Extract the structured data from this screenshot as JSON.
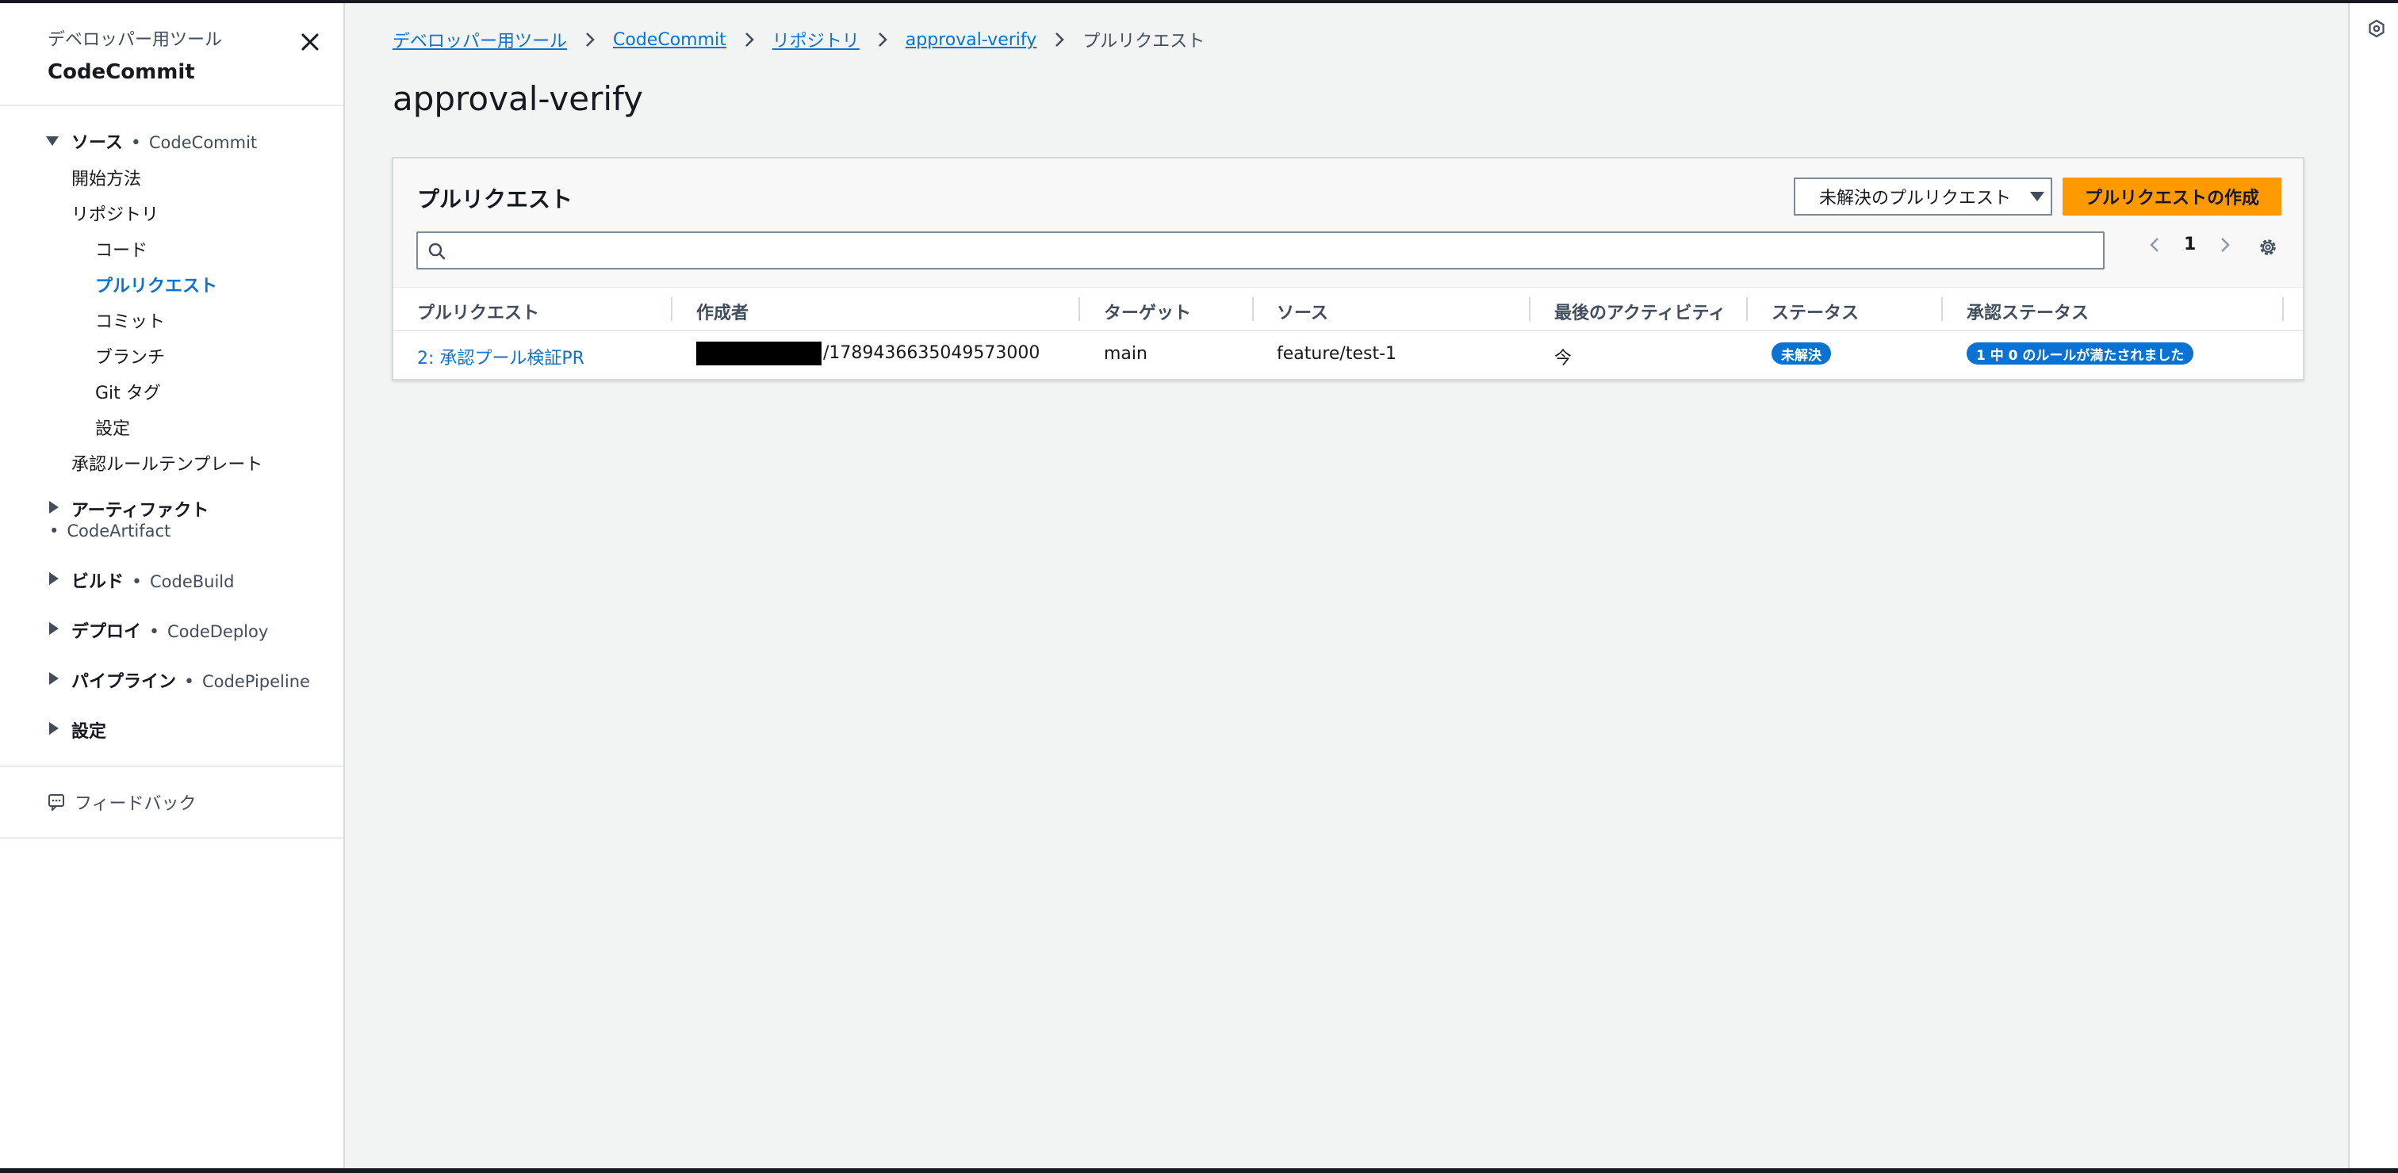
{
  "sidebar": {
    "supertitle": "デベロッパー用ツール",
    "title": "CodeCommit",
    "sections": {
      "source": {
        "label": "ソース",
        "service": "CodeCommit"
      },
      "artifact": {
        "label": "アーティファクト",
        "service": "CodeArtifact"
      },
      "build": {
        "label": "ビルド",
        "service": "CodeBuild"
      },
      "deploy": {
        "label": "デプロイ",
        "service": "CodeDeploy"
      },
      "pipeline": {
        "label": "パイプライン",
        "service": "CodePipeline"
      },
      "settings": {
        "label": "設定"
      }
    },
    "items": {
      "getting_started": "開始方法",
      "repositories": "リポジトリ",
      "code": "コード",
      "pull_requests": "プルリクエスト",
      "commits": "コミット",
      "branches": "ブランチ",
      "git_tags": "Git タグ",
      "repo_settings": "設定",
      "approval_templates": "承認ルールテンプレート"
    },
    "feedback": "フィードバック"
  },
  "breadcrumbs": {
    "c1": "デベロッパー用ツール",
    "c2": "CodeCommit",
    "c3": "リポジトリ",
    "c4": "approval-verify",
    "c5": "プルリクエスト"
  },
  "page_title": "approval-verify",
  "panel": {
    "title": "プルリクエスト",
    "filter_value": "未解決のプルリクエスト",
    "create_button": "プルリクエストの作成",
    "search_placeholder": "",
    "page_number": "1"
  },
  "table": {
    "headers": {
      "pr": "プルリクエスト",
      "author": "作成者",
      "target": "ターゲット",
      "source": "ソース",
      "activity": "最後のアクティビティ",
      "status": "ステータス",
      "approval": "承認ステータス"
    },
    "rows": [
      {
        "pr": "2: 承認プール検証PR",
        "author_suffix": "/1789436635049573000",
        "target": "main",
        "source": "feature/test-1",
        "activity": "今",
        "status": "未解決",
        "approval": "1 中 0 のルールが満たされました"
      }
    ]
  },
  "colors": {
    "accent": "#0972d3",
    "primary_button": "#ff9900",
    "background": "#f2f3f3"
  }
}
